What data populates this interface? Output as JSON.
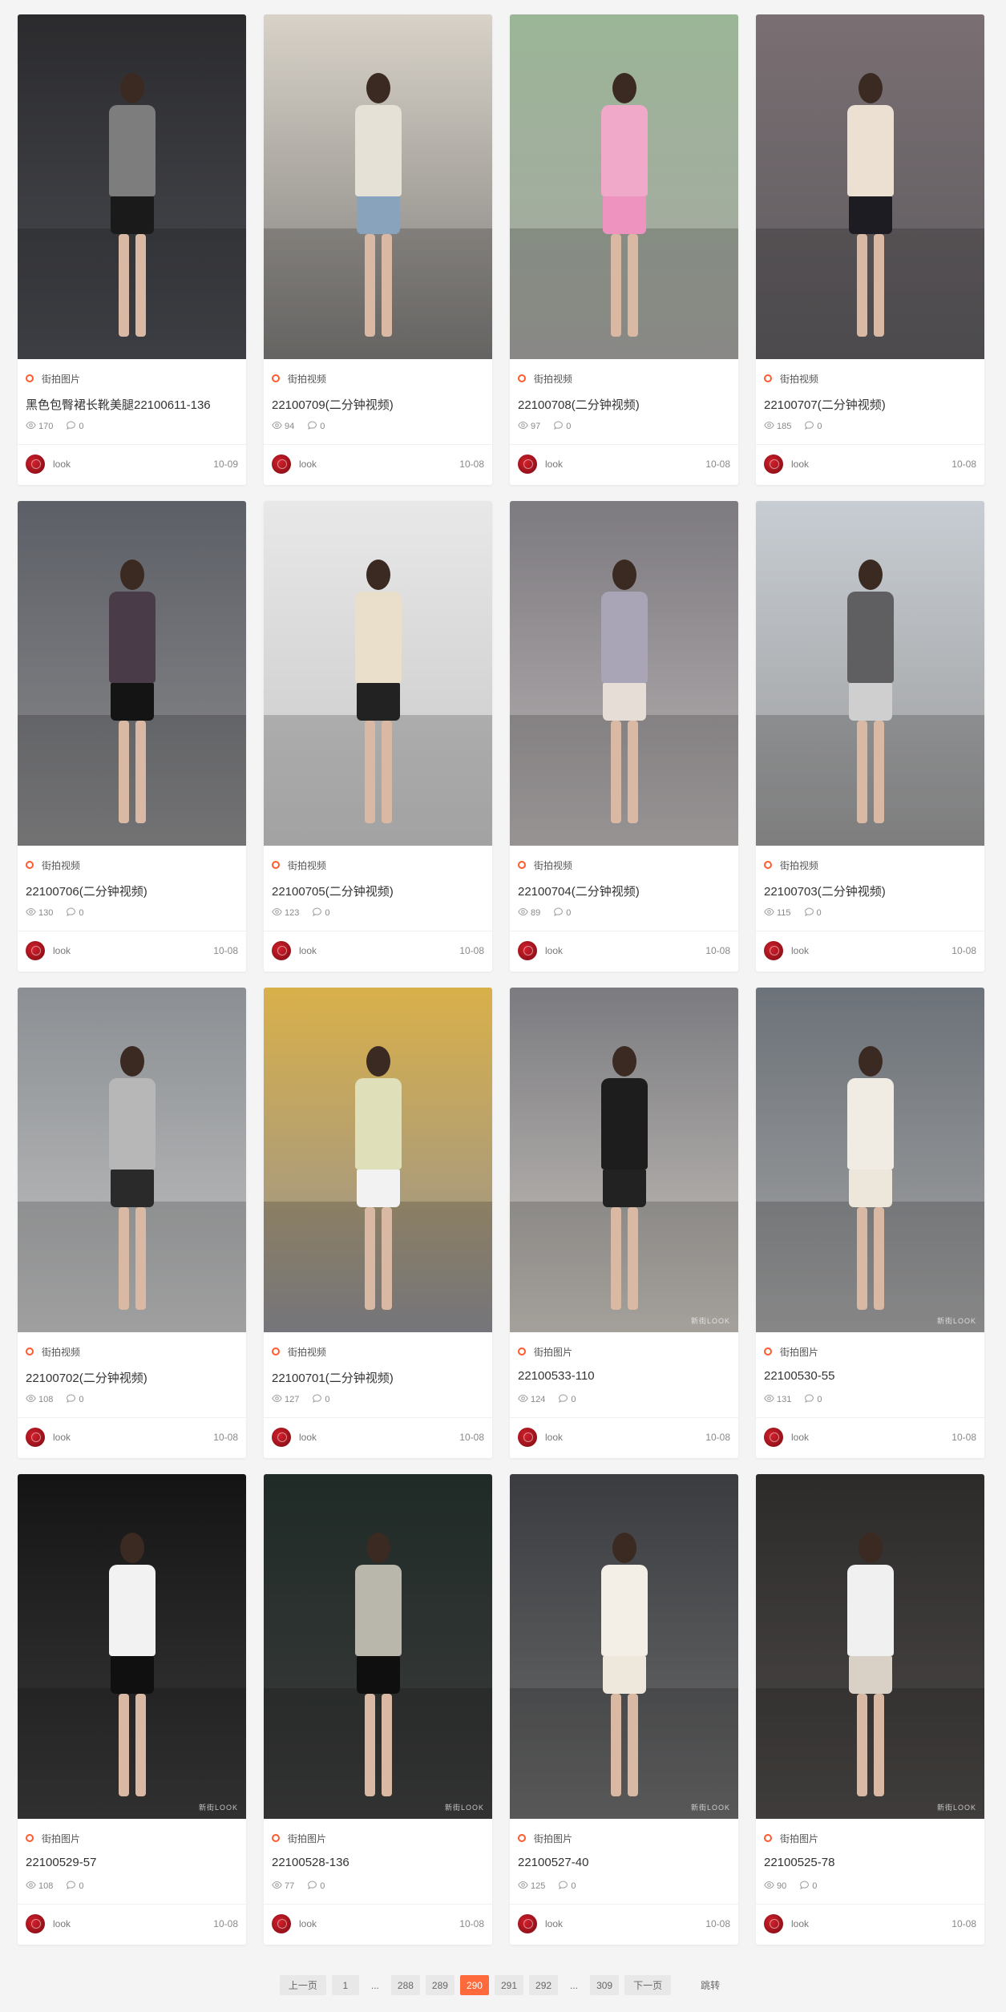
{
  "accent_color": "#ff5a2e",
  "active_page_color": "#ff6a3d",
  "cards": [
    {
      "category": "街拍图片",
      "title": "黑色包臀裙长靴美腿22100611-136",
      "views": "170",
      "comments": "0",
      "author": "look",
      "date": "10-09",
      "bg": [
        "#2b2b2e",
        "#4a4c52"
      ],
      "top": "#7d7d7d",
      "bottom": "#1a1a1a",
      "watermark": ""
    },
    {
      "category": "街拍视频",
      "title": "22100709(二分钟视频)",
      "views": "94",
      "comments": "0",
      "author": "look",
      "date": "10-08",
      "bg": [
        "#d8d2c8",
        "#7c7a78"
      ],
      "top": "#e6e1d7",
      "bottom": "#8aa3bd",
      "watermark": ""
    },
    {
      "category": "街拍视频",
      "title": "22100708(二分钟视频)",
      "views": "97",
      "comments": "0",
      "author": "look",
      "date": "10-08",
      "bg": [
        "#9bb597",
        "#a8a7a4"
      ],
      "top": "#f0a9c8",
      "bottom": "#ee93c0",
      "watermark": ""
    },
    {
      "category": "街拍视频",
      "title": "22100707(二分钟视频)",
      "views": "185",
      "comments": "0",
      "author": "look",
      "date": "10-08",
      "bg": [
        "#7a6f73",
        "#5d5b5e"
      ],
      "top": "#ece0d2",
      "bottom": "#1c1c22",
      "watermark": ""
    },
    {
      "category": "街拍视频",
      "title": "22100706(二分钟视频)",
      "views": "130",
      "comments": "0",
      "author": "look",
      "date": "10-08",
      "bg": [
        "#5c5f66",
        "#8c8c8e"
      ],
      "top": "#4a3b49",
      "bottom": "#141414",
      "watermark": ""
    },
    {
      "category": "街拍视频",
      "title": "22100705(二分钟视频)",
      "views": "123",
      "comments": "0",
      "author": "look",
      "date": "10-08",
      "bg": [
        "#e8e8e8",
        "#c6c6c6"
      ],
      "top": "#eadfca",
      "bottom": "#222222",
      "watermark": ""
    },
    {
      "category": "街拍视频",
      "title": "22100704(二分钟视频)",
      "views": "89",
      "comments": "0",
      "author": "look",
      "date": "10-08",
      "bg": [
        "#7d7a80",
        "#b9b4b4"
      ],
      "top": "#a9a5b6",
      "bottom": "#e6ddd6",
      "watermark": ""
    },
    {
      "category": "街拍视频",
      "title": "22100703(二分钟视频)",
      "views": "115",
      "comments": "0",
      "author": "look",
      "date": "10-08",
      "bg": [
        "#c7cdd3",
        "#9a9a9a"
      ],
      "top": "#5f5f62",
      "bottom": "#cfcfd0",
      "watermark": ""
    },
    {
      "category": "街拍视频",
      "title": "22100702(二分钟视频)",
      "views": "108",
      "comments": "0",
      "author": "look",
      "date": "10-08",
      "bg": [
        "#8b8f93",
        "#c3c3c3"
      ],
      "top": "#b7b7b7",
      "bottom": "#2a2a2a",
      "watermark": ""
    },
    {
      "category": "街拍视频",
      "title": "22100701(二分钟视频)",
      "views": "127",
      "comments": "0",
      "author": "look",
      "date": "10-08",
      "bg": [
        "#d9b04a",
        "#8f8f96"
      ],
      "top": "#dfe0b9",
      "bottom": "#f2f2f2",
      "watermark": ""
    },
    {
      "category": "街拍图片",
      "title": "22100533-110",
      "views": "124",
      "comments": "0",
      "author": "look",
      "date": "10-08",
      "bg": [
        "#7b7b80",
        "#c9c4bd"
      ],
      "top": "#1d1d1d",
      "bottom": "#222222",
      "watermark": "新街LOOK"
    },
    {
      "category": "街拍图片",
      "title": "22100530-55",
      "views": "131",
      "comments": "0",
      "author": "look",
      "date": "10-08",
      "bg": [
        "#6c7279",
        "#a5a5a5"
      ],
      "top": "#f1ece3",
      "bottom": "#ede6da",
      "watermark": "新街LOOK"
    },
    {
      "category": "街拍图片",
      "title": "22100529-57",
      "views": "108",
      "comments": "0",
      "author": "look",
      "date": "10-08",
      "bg": [
        "#141414",
        "#3b3b3b"
      ],
      "top": "#f2f2f2",
      "bottom": "#101010",
      "watermark": "新街LOOK"
    },
    {
      "category": "街拍图片",
      "title": "22100528-136",
      "views": "77",
      "comments": "0",
      "author": "look",
      "date": "10-08",
      "bg": [
        "#1f2a26",
        "#3d3d3d"
      ],
      "top": "#b9b7ab",
      "bottom": "#0f0f0f",
      "watermark": "新街LOOK"
    },
    {
      "category": "街拍图片",
      "title": "22100527-40",
      "views": "125",
      "comments": "0",
      "author": "look",
      "date": "10-08",
      "bg": [
        "#3a3c40",
        "#6c6c6c"
      ],
      "top": "#f3efe6",
      "bottom": "#eee8dc",
      "watermark": "新街LOOK"
    },
    {
      "category": "街拍图片",
      "title": "22100525-78",
      "views": "90",
      "comments": "0",
      "author": "look",
      "date": "10-08",
      "bg": [
        "#2d2b2a",
        "#4d4a48"
      ],
      "top": "#f0f0f0",
      "bottom": "#d9d0c6",
      "watermark": "新街LOOK"
    }
  ],
  "pagination": {
    "prev": "上一页",
    "first": "1",
    "ellipsis_left": "...",
    "pages": [
      "288",
      "289",
      "290",
      "291",
      "292"
    ],
    "active": "290",
    "ellipsis_right": "...",
    "last": "309",
    "next": "下一页",
    "jump": "跳转"
  }
}
